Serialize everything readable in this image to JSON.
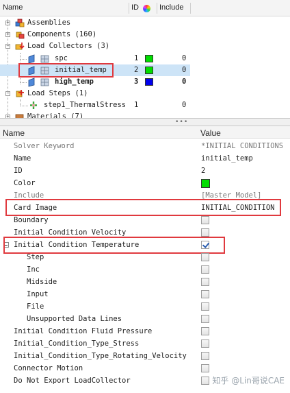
{
  "tree": {
    "columns": {
      "name": "Name",
      "id": "ID",
      "include": "Include"
    },
    "rows": [
      {
        "label": "Assemblies"
      },
      {
        "label": "Components (160)"
      },
      {
        "label": "Load Collectors (3)"
      },
      {
        "label": "spc",
        "id": "1",
        "color": "#00dd00",
        "include": "0"
      },
      {
        "label": "initial_temp",
        "id": "2",
        "color": "#00dd00",
        "include": "0"
      },
      {
        "label": "high_temp",
        "id": "3",
        "color": "#0000ee",
        "include": "0"
      },
      {
        "label": "Load Steps (1)"
      },
      {
        "label": "step1_ThermalStress",
        "id": "1",
        "include": "0"
      },
      {
        "label": "Materials (7)"
      }
    ],
    "splitter_grip": "•••"
  },
  "properties": {
    "columns": {
      "name": "Name",
      "value": "Value"
    },
    "rows": [
      {
        "name": "Solver Keyword",
        "value": "*INITIAL CONDITIONS"
      },
      {
        "name": "Name",
        "value": "initial_temp"
      },
      {
        "name": "ID",
        "value": "2"
      },
      {
        "name": "Color",
        "color": "#00dd00"
      },
      {
        "name": "Include",
        "value": "[Master Model]"
      },
      {
        "name": "Card Image",
        "value": "INITIAL_CONDITION"
      },
      {
        "name": "Boundary",
        "checked": false
      },
      {
        "name": "Initial Condition Velocity",
        "checked": false
      },
      {
        "name": "Initial Condition Temperature",
        "checked": true
      },
      {
        "name": "Step",
        "checked": false
      },
      {
        "name": "Inc",
        "checked": false
      },
      {
        "name": "Midside",
        "checked": false
      },
      {
        "name": "Input",
        "checked": false
      },
      {
        "name": "File",
        "checked": false
      },
      {
        "name": "Unsupported Data Lines",
        "checked": false
      },
      {
        "name": "Initial Condition Fluid Pressure",
        "checked": false
      },
      {
        "name": "Initial_Condition_Type_Stress",
        "checked": false
      },
      {
        "name": "Initial_Condition_Type_Rotating_Velocity",
        "checked": false
      },
      {
        "name": "Connector Motion",
        "checked": false
      },
      {
        "name": "Do Not Export LoadCollector",
        "checked": false
      }
    ]
  },
  "watermark": "知乎 @Lin哥说CAE"
}
